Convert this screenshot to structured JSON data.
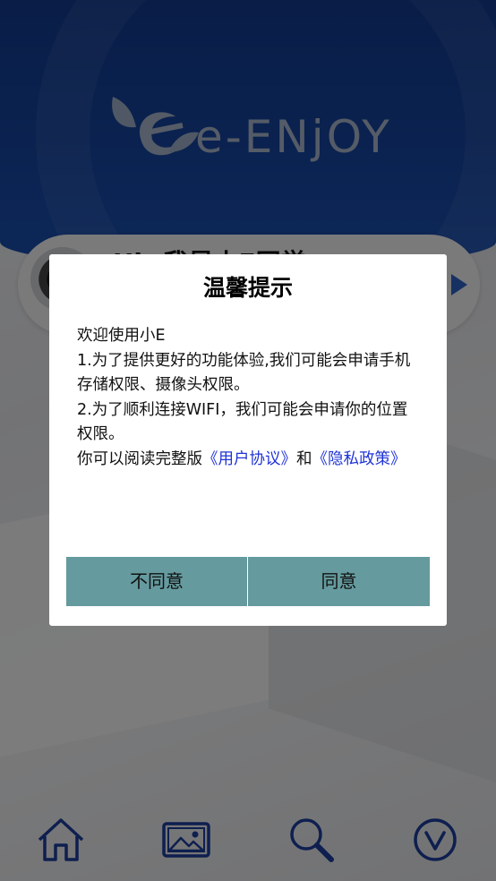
{
  "header": {
    "logo_text": "e-ENjOY"
  },
  "banner": {
    "greeting": "Hi~我是小E同学"
  },
  "dialog": {
    "title": "温馨提示",
    "body": {
      "line1": "欢迎使用小E",
      "line2": "1.为了提供更好的功能体验,我们可能会申请手机存储权限、摄像头权限。",
      "line3": "2.为了顺利连接WIFI，我们可能会申请你的位置权限。",
      "line4_prefix": "你可以阅读完整版",
      "user_agreement_link": "《用户协议》",
      "conjunction": "和",
      "privacy_policy_link": "《隐私政策》"
    },
    "disagree_label": "不同意",
    "agree_label": "同意"
  },
  "bottom_nav": {
    "items": [
      {
        "icon": "home-icon"
      },
      {
        "icon": "gallery-icon"
      },
      {
        "icon": "search-icon"
      },
      {
        "icon": "chevron-down-circle-icon"
      }
    ]
  },
  "colors": {
    "header_blue": "#1a4fb0",
    "button_teal": "#659a9e",
    "link_blue": "#1f33d6",
    "nav_icon_blue": "#1d3f9e"
  }
}
